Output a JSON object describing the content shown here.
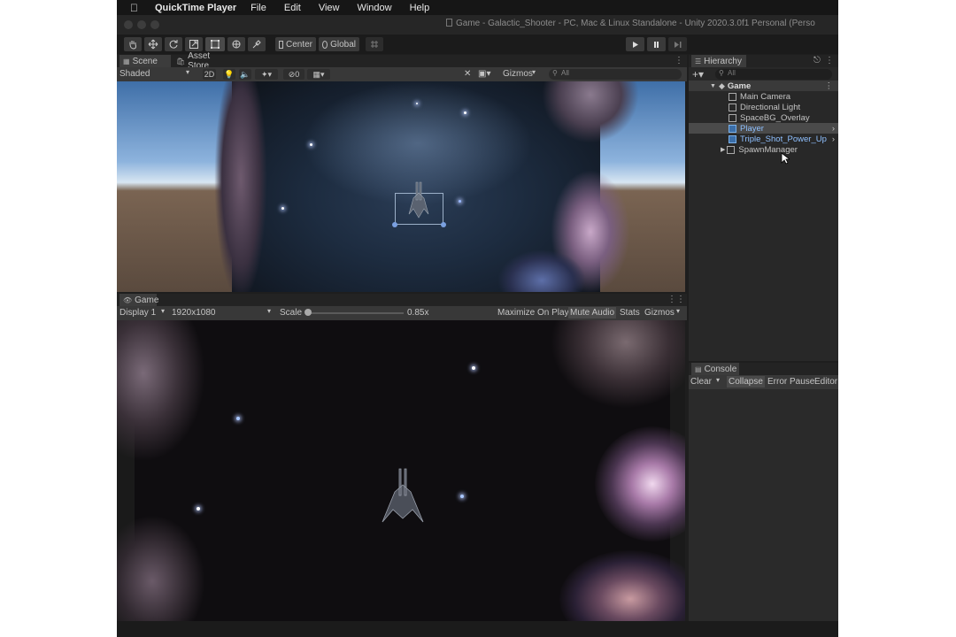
{
  "menubar": {
    "app_name": "QuickTime Player",
    "items": [
      "File",
      "Edit",
      "View",
      "Window",
      "Help"
    ]
  },
  "window": {
    "title": "Game - Galactic_Shooter - PC, Mac & Linux Standalone - Unity 2020.3.0f1 Personal (Perso"
  },
  "toolbar": {
    "center_label": "Center",
    "global_label": "Global",
    "icons": [
      "hand-tool-icon",
      "move-tool-icon",
      "rotate-tool-icon",
      "scale-tool-icon",
      "rect-tool-icon",
      "transform-tool-icon",
      "custom-tool-icon"
    ],
    "play_icons": [
      "play-icon",
      "pause-icon",
      "step-icon"
    ]
  },
  "scene_panel": {
    "tabs": [
      "Scene",
      "Asset Store"
    ],
    "shading_mode": "Shaded",
    "mode_2d": "2D",
    "hidden_count": "0",
    "gizmos_label": "Gizmos",
    "search_placeholder": "All"
  },
  "game_panel": {
    "tab": "Game",
    "display": "Display 1",
    "resolution": "1920x1080",
    "scale_label": "Scale",
    "scale_value": "0.85x",
    "maximize_label": "Maximize On Play",
    "mute_label": "Mute Audio",
    "stats_label": "Stats",
    "gizmos_label": "Gizmos"
  },
  "hierarchy": {
    "tab": "Hierarchy",
    "search_placeholder": "All",
    "scene_name": "Game",
    "items": [
      {
        "label": "Main Camera",
        "prefab": false
      },
      {
        "label": "Directional Light",
        "prefab": false
      },
      {
        "label": "SpaceBG_Overlay",
        "prefab": false
      },
      {
        "label": "Player",
        "prefab": true,
        "selected": true
      },
      {
        "label": "Triple_Shot_Power_Up",
        "prefab": true
      },
      {
        "label": "SpawnManager",
        "prefab": false
      }
    ]
  },
  "console": {
    "tab": "Console",
    "clear_label": "Clear",
    "collapse_label": "Collapse",
    "error_pause_label": "Error Pause",
    "editor_label": "Editor"
  }
}
